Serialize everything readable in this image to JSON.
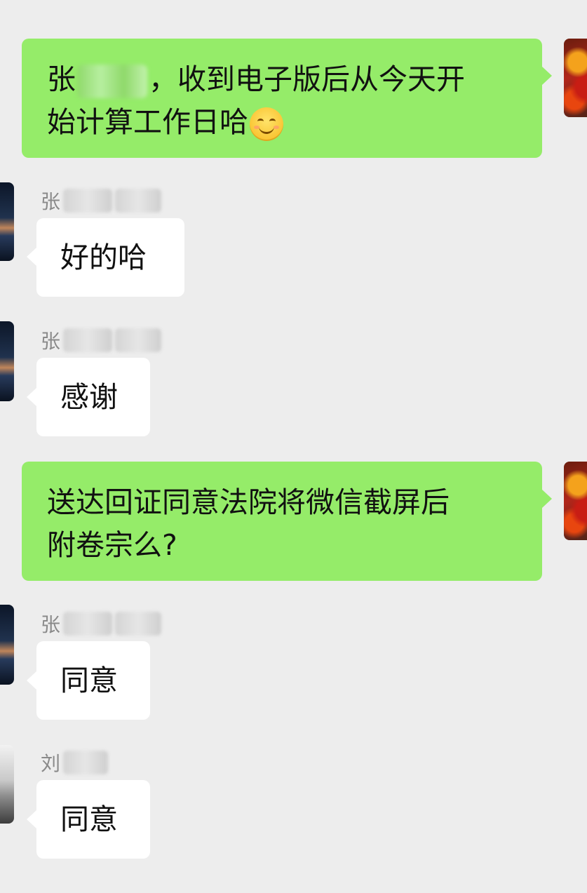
{
  "messages": [
    {
      "side": "right",
      "line1_pre": "张",
      "line1_post": "，收到电子版后从今天开",
      "line2": "始计算工作日哈",
      "emoji": "smiling-face-emoji"
    },
    {
      "side": "left",
      "sender_visible": "张",
      "text": "好的哈"
    },
    {
      "side": "left",
      "sender_visible": "张",
      "text": "感谢"
    },
    {
      "side": "right",
      "line1": "送达回证同意法院将微信截屏后",
      "line2": "附卷宗么?"
    },
    {
      "side": "left",
      "sender_visible": "张",
      "text": "同意"
    },
    {
      "side": "left",
      "sender_visible": "刘",
      "text": "同意"
    }
  ],
  "colors": {
    "background": "#ededed",
    "outgoing_bubble": "#95ec69",
    "incoming_bubble": "#ffffff",
    "sender_name": "#8a8a8a"
  }
}
